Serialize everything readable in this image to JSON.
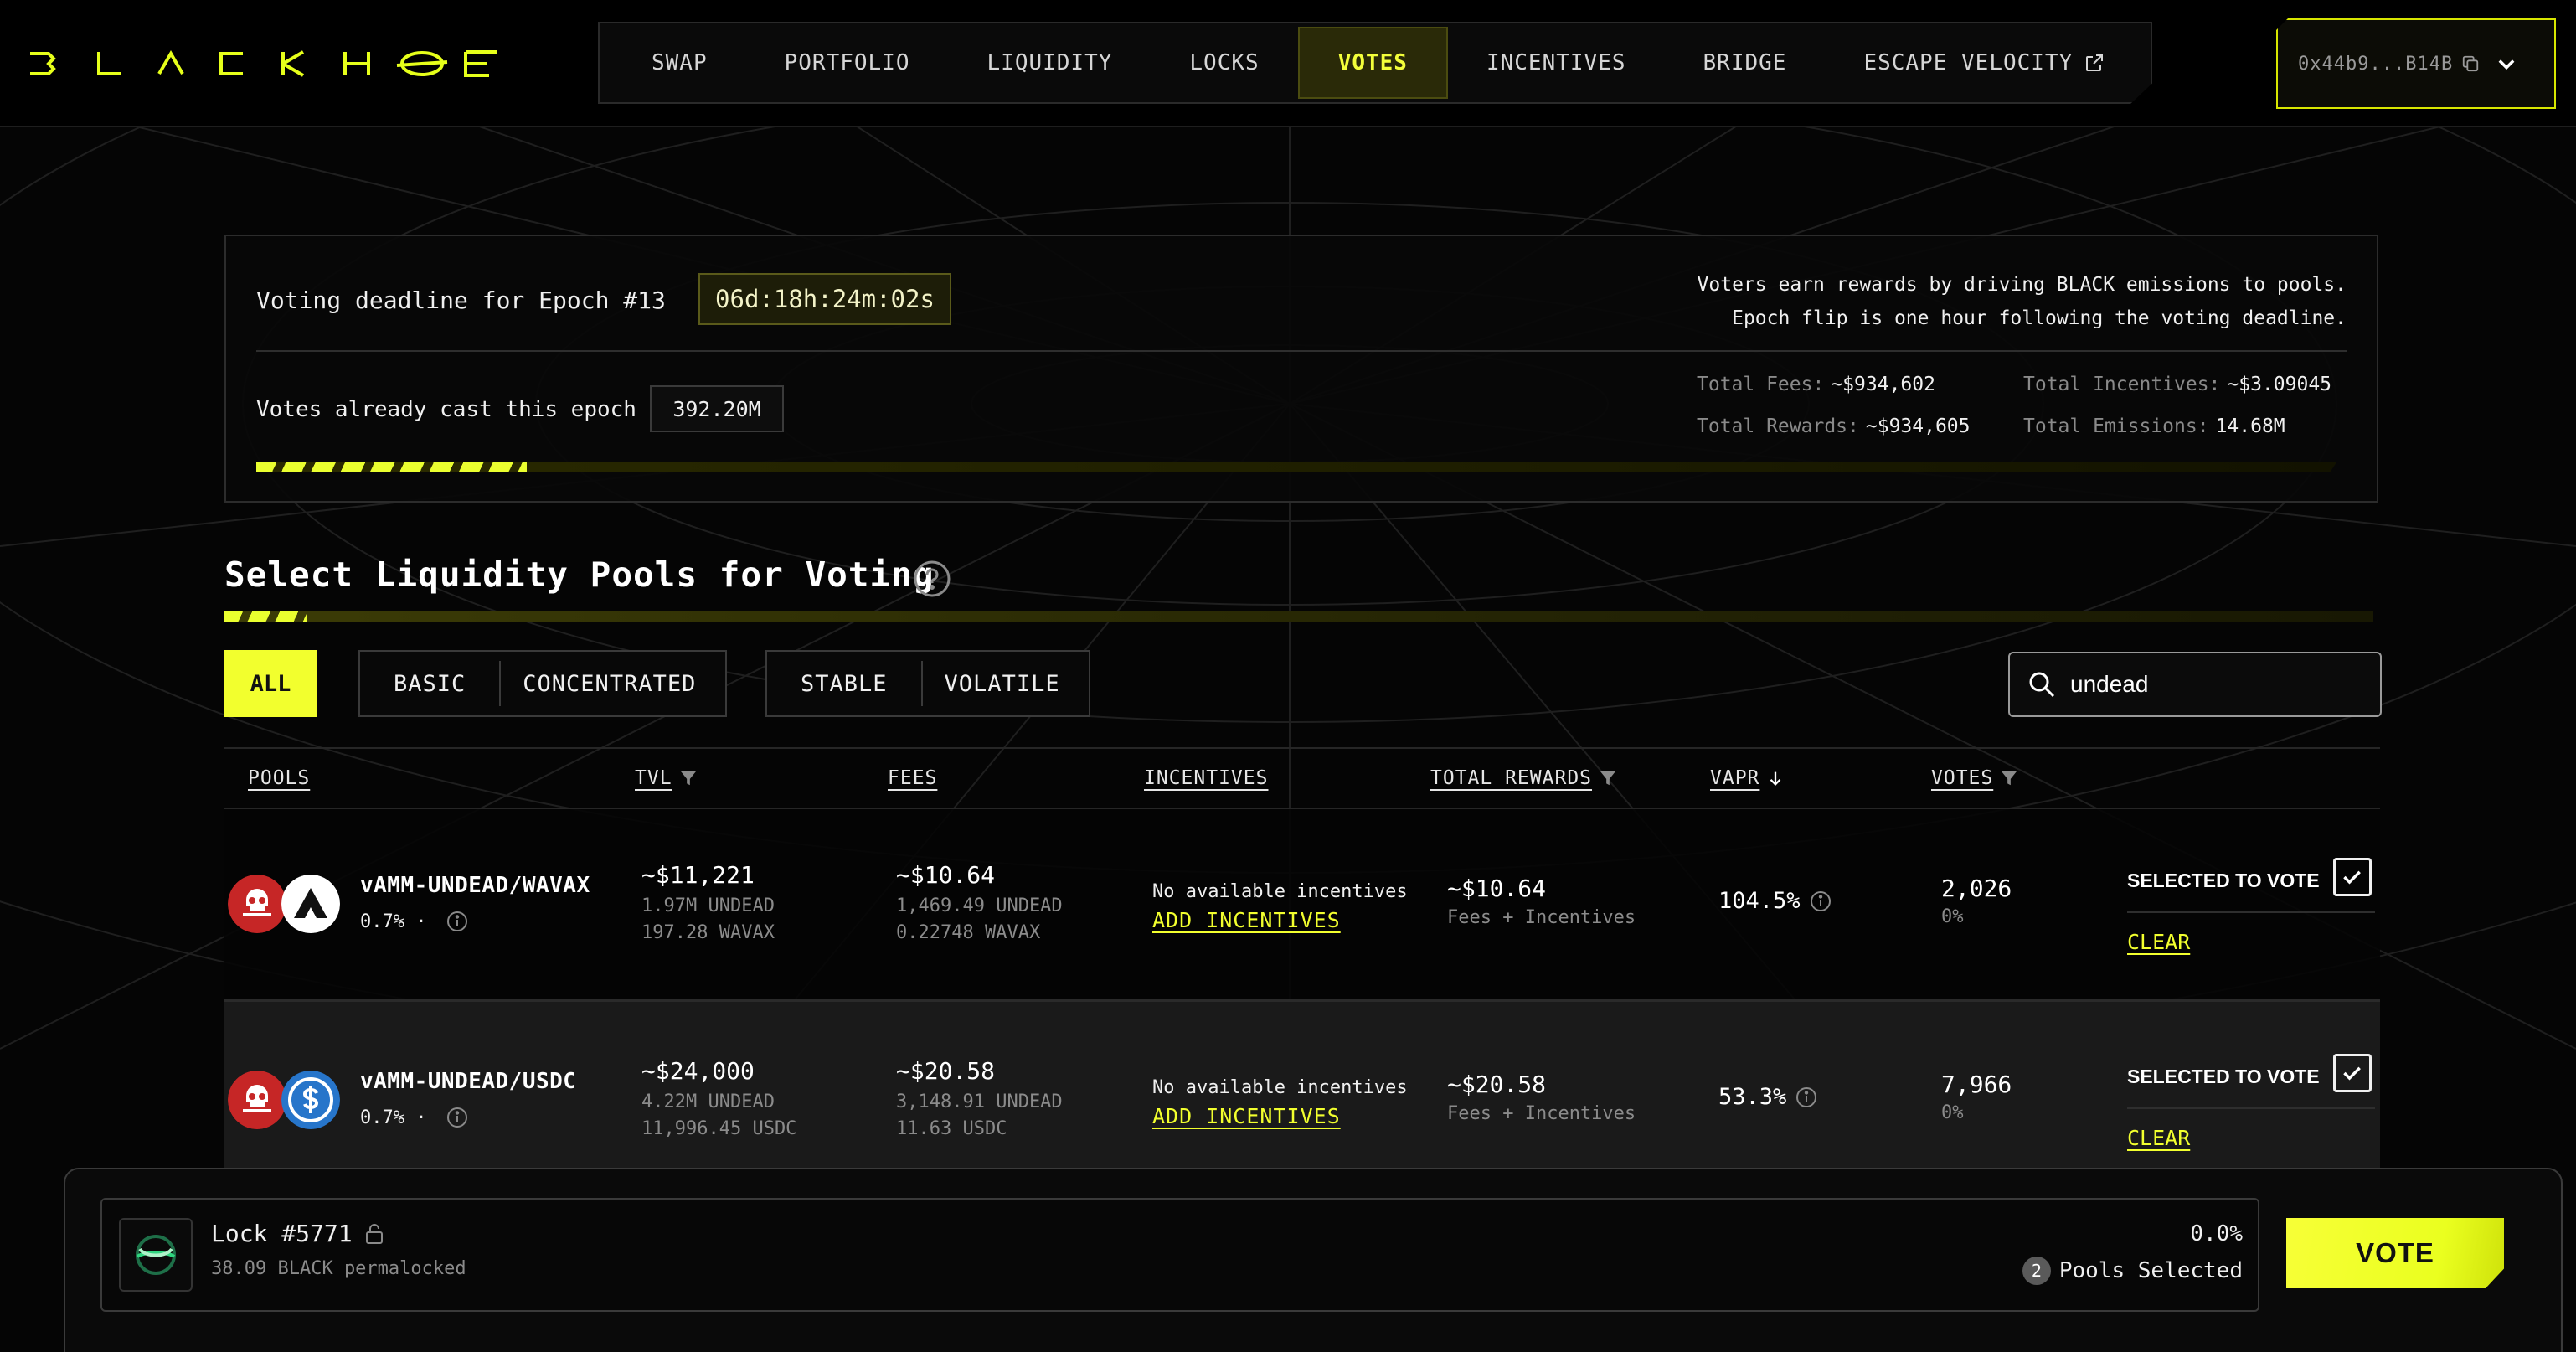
{
  "brand": {
    "name": "BLACKHOLE",
    "accent": "#f2ff2e"
  },
  "nav": {
    "items": [
      "SWAP",
      "PORTFOLIO",
      "LIQUIDITY",
      "LOCKS",
      "VOTES",
      "INCENTIVES",
      "BRIDGE",
      "ESCAPE VELOCITY"
    ],
    "active": "VOTES"
  },
  "wallet": {
    "address": "0x44b9...B14B"
  },
  "epoch": {
    "deadline_label": "Voting deadline for Epoch #13",
    "deadline_value": "06d:18h:24m:02s",
    "info_line1": "Voters earn rewards by driving BLACK emissions to pools.",
    "info_line2": "Epoch flip is one hour following the voting deadline.",
    "cast_label": "Votes already cast this epoch",
    "cast_value": "392.20M",
    "total_fees_label": "Total Fees:",
    "total_fees": "~$934,602",
    "total_incentives_label": "Total Incentives:",
    "total_incentives": "~$3.09045",
    "total_rewards_label": "Total Rewards:",
    "total_rewards": "~$934,605",
    "total_emissions_label": "Total Emissions:",
    "total_emissions": "14.68M",
    "progress_fraction": 0.13
  },
  "section": {
    "title": "Select Liquidity Pools for Voting"
  },
  "filters": {
    "all": "ALL",
    "basic": "BASIC",
    "concentrated": "CONCENTRATED",
    "stable": "STABLE",
    "volatile": "VOLATILE"
  },
  "search": {
    "value": "undead"
  },
  "table": {
    "headers": {
      "pools": "POOLS",
      "tvl": "TVL",
      "fees": "FEES",
      "incentives": "INCENTIVES",
      "total_rewards": "TOTAL REWARDS",
      "vapr": "VAPR",
      "votes": "VOTES"
    },
    "rows": [
      {
        "pair": "vAMM-UNDEAD/WAVAX",
        "fee": "0.7% ·",
        "tvl": "~$11,221",
        "tvl_a": "1.97M UNDEAD",
        "tvl_b": "197.28 WAVAX",
        "fees": "~$10.64",
        "fees_a": "1,469.49 UNDEAD",
        "fees_b": "0.22748 WAVAX",
        "incentives_text": "No available incentives",
        "add_incentives": "ADD INCENTIVES",
        "rewards": "~$10.64",
        "rewards_sub": "Fees + Incentives",
        "vapr": "104.5%",
        "votes": "2,026",
        "votes_pct": "0%",
        "selected_label": "SELECTED TO VOTE",
        "clear": "CLEAR",
        "token_b_icon": "avax-icon"
      },
      {
        "pair": "vAMM-UNDEAD/USDC",
        "fee": "0.7% ·",
        "tvl": "~$24,000",
        "tvl_a": "4.22M UNDEAD",
        "tvl_b": "11,996.45 USDC",
        "fees": "~$20.58",
        "fees_a": "3,148.91 UNDEAD",
        "fees_b": "11.63 USDC",
        "incentives_text": "No available incentives",
        "add_incentives": "ADD INCENTIVES",
        "rewards": "~$20.58",
        "rewards_sub": "Fees + Incentives",
        "vapr": "53.3%",
        "votes": "7,966",
        "votes_pct": "0%",
        "selected_label": "SELECTED TO VOTE",
        "clear": "CLEAR",
        "token_b_icon": "usdc-icon"
      }
    ]
  },
  "lock": {
    "title": "Lock #5771",
    "subtitle": "38.09 BLACK permalocked",
    "percent": "0.0%",
    "pools_count": "2",
    "pools_label": "Pools Selected",
    "vote_button": "VOTE"
  }
}
